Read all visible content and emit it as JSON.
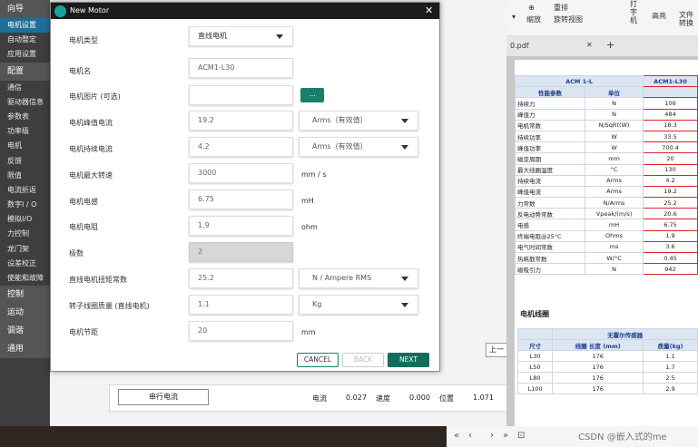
{
  "left_nav": [
    {
      "label": "向导",
      "style": "header"
    },
    {
      "label": "电机设置",
      "style": "active"
    },
    {
      "label": "自动整定",
      "style": "item"
    },
    {
      "label": "应用设置",
      "style": "item"
    },
    {
      "label": "配置",
      "style": "header"
    },
    {
      "label": "通信",
      "style": "item"
    },
    {
      "label": "驱动器信息",
      "style": "item"
    },
    {
      "label": "参数表",
      "style": "item"
    },
    {
      "label": "功率级",
      "style": "item"
    },
    {
      "label": "电机",
      "style": "item"
    },
    {
      "label": "反馈",
      "style": "item"
    },
    {
      "label": "限值",
      "style": "item"
    },
    {
      "label": "电流折返",
      "style": "item"
    },
    {
      "label": "数字I / O",
      "style": "item"
    },
    {
      "label": "模拟I/O",
      "style": "item"
    },
    {
      "label": "力控制",
      "style": "item"
    },
    {
      "label": "龙门架",
      "style": "item"
    },
    {
      "label": "设差校正",
      "style": "item"
    },
    {
      "label": "使能和故障",
      "style": "item"
    },
    {
      "label": "控制",
      "style": "header"
    },
    {
      "label": "运动",
      "style": "header"
    },
    {
      "label": "调谐",
      "style": "header"
    },
    {
      "label": "通用",
      "style": "header"
    }
  ],
  "dialog": {
    "title": "New Motor",
    "close_glyph": "✕",
    "motor_type_label": "电机类型",
    "motor_type_value": "直线电机",
    "motor_name_label": "电机名",
    "motor_name_value": "ACM1-L30",
    "motor_image_label": "电机图片 (可选)",
    "motor_image_value": "",
    "browse_label": "...",
    "peak_current_label": "电机峰值电流",
    "peak_current_value": "19.2",
    "peak_current_unit": "Arms（有效值）",
    "cont_current_label": "电机持续电流",
    "cont_current_value": "4.2",
    "cont_current_unit": "Arms（有效值）",
    "max_speed_label": "电机最大转速",
    "max_speed_value": "3000",
    "max_speed_unit": "mm / s",
    "inductance_label": "电机电感",
    "inductance_value": "6.75",
    "inductance_unit": "mH",
    "resistance_label": "电机电阻",
    "resistance_value": "1.9",
    "resistance_unit": "ohm",
    "poles_label": "极数",
    "poles_value": "2",
    "torque_const_label": "直线电机扭矩常数",
    "torque_const_value": "25.2",
    "torque_const_unit": "N / Ampere RMS",
    "rotor_mass_label": "转子线圈质量 (直线电机)",
    "rotor_mass_value": "1.1",
    "rotor_mass_unit": "Kg",
    "pitch_label": "电机节距",
    "pitch_value": "20",
    "pitch_unit": "mm",
    "cancel_label": "CANCEL",
    "back_label": "BACK",
    "next_label": "NEXT"
  },
  "status_bar": {
    "button_label": "串行电流",
    "current_label": "电流",
    "current_value": "0.027",
    "speed_label": "速度",
    "speed_value": "0.000",
    "position_label": "位置",
    "position_value": "1.071",
    "side_button": "上一"
  },
  "pdf_viewer": {
    "ribbon": {
      "zoom_label": "缩放",
      "rearrange_label": "重排",
      "rotate_label": "旋转视图",
      "typewriter_label": "打字机",
      "highlight_label": "高亮",
      "convert_label": "文件转换"
    },
    "tab_name": "0.pdf",
    "add_tab": "+",
    "spec_header": {
      "series": "ACM 1-L",
      "model": "ACM1-L30"
    },
    "spec_colheads": {
      "param": "性能参数",
      "unit": "单位"
    },
    "spec_rows": [
      {
        "param": "持续力",
        "unit": "N",
        "value": "106"
      },
      {
        "param": "峰值力",
        "unit": "N",
        "value": "484"
      },
      {
        "param": "电机常数",
        "unit": "N/SqRt(W)",
        "value": "18.3"
      },
      {
        "param": "持续功率",
        "unit": "W",
        "value": "33.5"
      },
      {
        "param": "峰值功率",
        "unit": "W",
        "value": "700.4"
      },
      {
        "param": "磁变周期",
        "unit": "mm",
        "value": "20"
      },
      {
        "param": "最大线圈温度",
        "unit": "°C",
        "value": "130"
      },
      {
        "param": "持续电流",
        "unit": "Arms",
        "value": "4.2"
      },
      {
        "param": "峰值电流",
        "unit": "Arms",
        "value": "19.2"
      },
      {
        "param": "力常数",
        "unit": "N/Arms",
        "value": "25.2"
      },
      {
        "param": "反电动势常数",
        "unit": "Vpeak/(m/s)",
        "value": "20.6"
      },
      {
        "param": "电感",
        "unit": "mH",
        "value": "6.75"
      },
      {
        "param": "终端电阻@25°C",
        "unit": "Ohms",
        "value": "1.9"
      },
      {
        "param": "电气时间常数",
        "unit": "ms",
        "value": "3.6"
      },
      {
        "param": "热耗散常数",
        "unit": "W/°C",
        "value": "0.45"
      },
      {
        "param": "磁吸引力",
        "unit": "N",
        "value": "942"
      }
    ],
    "section_title": "电机线圈",
    "hall_header": "无霍尔传感器",
    "line_heads": {
      "size": "尺寸",
      "len": "线圈 长度 (mm)",
      "mass": "质量(kg)"
    },
    "line_rows": [
      {
        "size": "L30",
        "len": "176",
        "mass": "1.1"
      },
      {
        "size": "L50",
        "len": "176",
        "mass": "1.7"
      },
      {
        "size": "L80",
        "len": "176",
        "mass": "2.5"
      },
      {
        "size": "L100",
        "len": "176",
        "mass": "2.9"
      }
    ]
  },
  "watermark": "CSDN @嵌入式的me",
  "colors": {
    "accent": "#0f6e5e",
    "nav_active": "#1d6f98",
    "highlight_box": "#d22233"
  }
}
